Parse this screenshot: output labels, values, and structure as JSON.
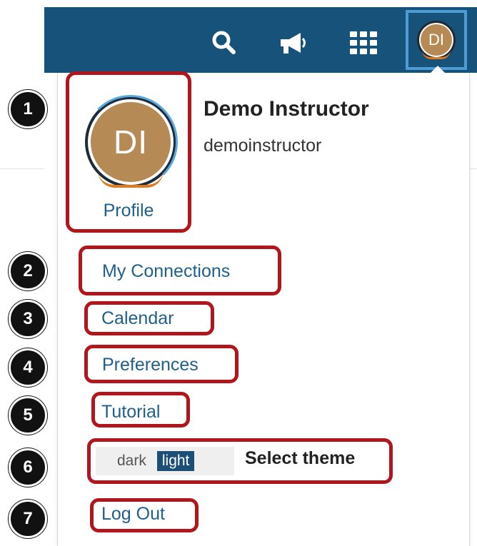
{
  "header": {
    "search_icon": "search-icon",
    "announcements_icon": "megaphone-icon",
    "apps_icon": "grid-icon",
    "avatar_initials": "DI"
  },
  "profile": {
    "avatar_initials": "DI",
    "link_label": "Profile",
    "display_name": "Demo Instructor",
    "username": "demoinstructor"
  },
  "menu": {
    "connections": "My Connections",
    "calendar": "Calendar",
    "preferences": "Preferences",
    "tutorial": "Tutorial",
    "logout": "Log Out"
  },
  "theme": {
    "dark": "dark",
    "light": "light",
    "selected": "light",
    "label": "Select theme"
  },
  "steps": [
    "1",
    "2",
    "3",
    "4",
    "5",
    "6",
    "7"
  ],
  "colors": {
    "nav_bar": "#17527a",
    "link": "#1f5f8b",
    "highlight_frame": "#b0161c",
    "avatar_bg": "#b58a55",
    "theme_active": "#1d4f76"
  }
}
